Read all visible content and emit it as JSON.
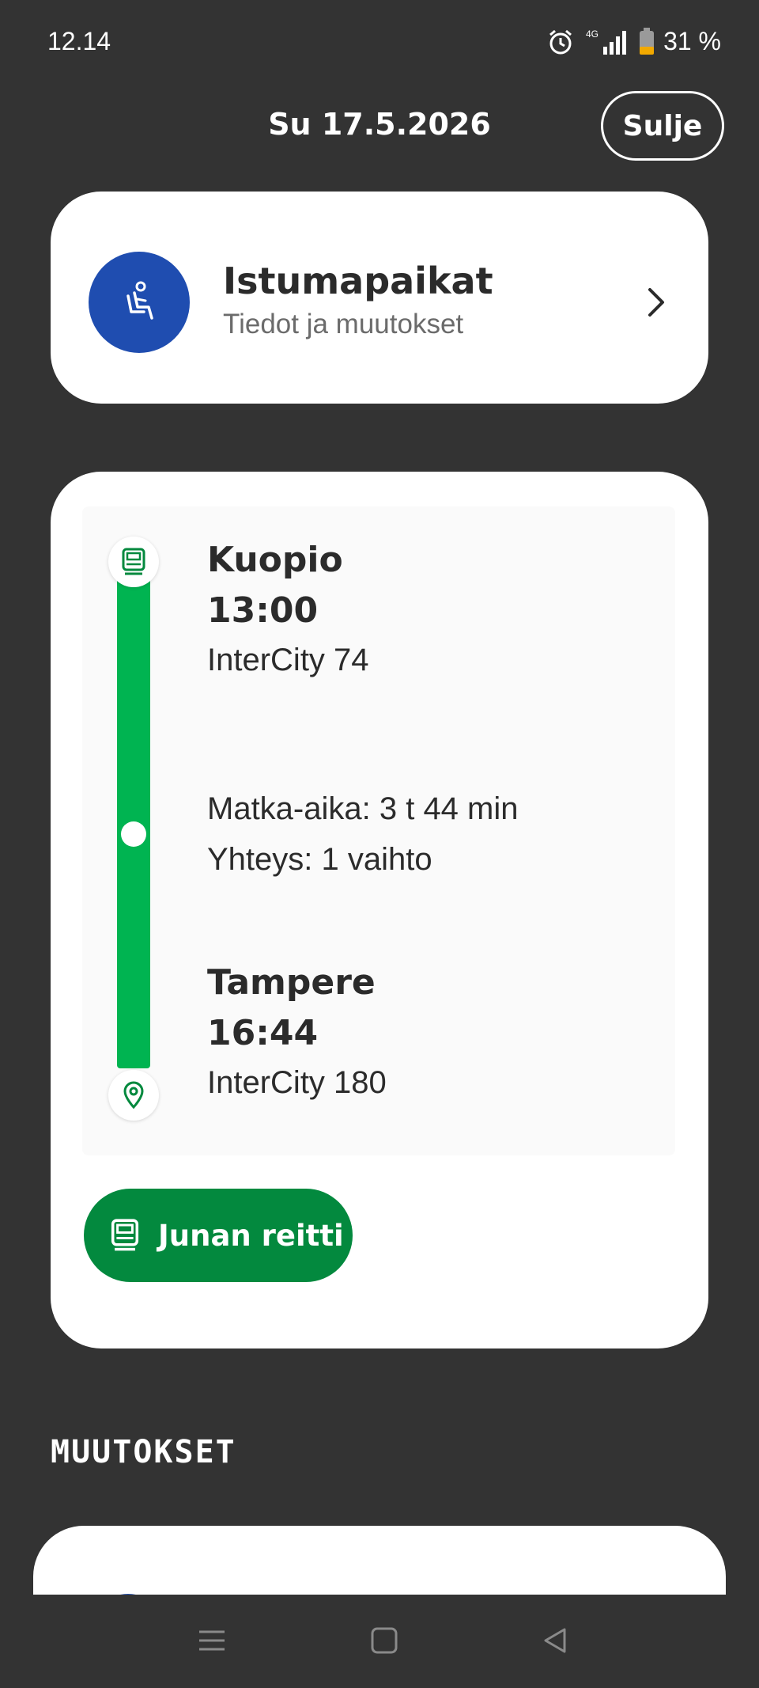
{
  "status_bar": {
    "time": "12.14",
    "network": "4G",
    "battery": "31 %"
  },
  "header": {
    "date": "Su 17.5.2026",
    "close_label": "Sulje"
  },
  "seats_card": {
    "title": "Istumapaikat",
    "subtitle": "Tiedot ja muutokset",
    "icon": "seat-icon"
  },
  "journey": {
    "departure": {
      "station": "Kuopio",
      "time": "13:00",
      "train": "InterCity 74"
    },
    "duration": "Matka-aika: 3 t 44 min",
    "connection": "Yhteys: 1 vaihto",
    "arrival": {
      "station": "Tampere",
      "time": "16:44",
      "train": "InterCity 180"
    },
    "route_button_label": "Junan reitti"
  },
  "changes_section": {
    "heading": "MUUTOKSET"
  },
  "colors": {
    "background": "#333333",
    "accent_blue": "#1f4db0",
    "route_green": "#00b451",
    "button_green": "#03893e"
  }
}
